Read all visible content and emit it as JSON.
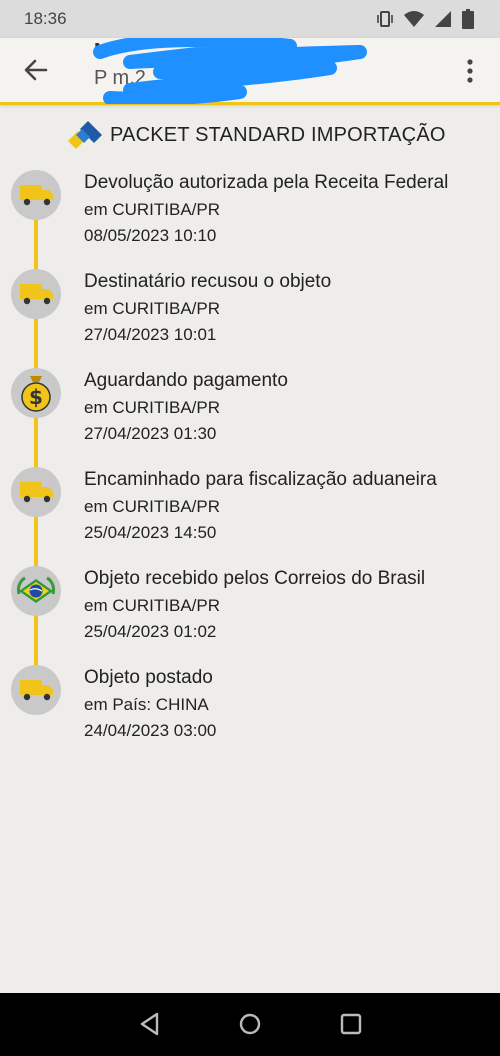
{
  "status_bar": {
    "time": "18:36"
  },
  "header": {
    "title": "N",
    "subtitle": "P m.2"
  },
  "service": {
    "label": "PACKET STANDARD IMPORTAÇÃO"
  },
  "events": [
    {
      "title": "Devolução autorizada pela Receita Federal",
      "place": "em CURITIBA/PR",
      "date": "08/05/2023 10:10",
      "icon": "truck-icon"
    },
    {
      "title": "Destinatário recusou o objeto",
      "place": "em CURITIBA/PR",
      "date": "27/04/2023 10:01",
      "icon": "truck-icon"
    },
    {
      "title": "Aguardando pagamento",
      "place": "em CURITIBA/PR",
      "date": "27/04/2023 01:30",
      "icon": "money-bag-icon"
    },
    {
      "title": "Encaminhado para fiscalização aduaneira",
      "place": "em CURITIBA/PR",
      "date": "25/04/2023 14:50",
      "icon": "truck-icon"
    },
    {
      "title": "Objeto recebido pelos Correios do Brasil",
      "place": "em CURITIBA/PR",
      "date": "25/04/2023 01:02",
      "icon": "brazil-flag-icon"
    },
    {
      "title": "Objeto postado",
      "place": "em País: CHINA",
      "date": "24/04/2023 03:00",
      "icon": "truck-icon"
    }
  ],
  "colors": {
    "accent": "#f0c419",
    "background": "#eeedea",
    "icon_circle": "#c9c9c9",
    "redaction": "#1e90ff"
  }
}
